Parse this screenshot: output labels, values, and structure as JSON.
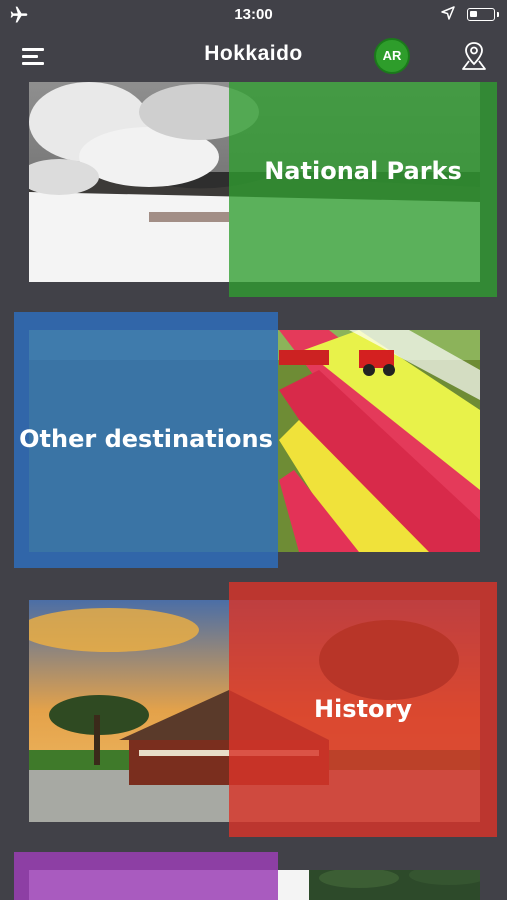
{
  "status_bar": {
    "time": "13:00",
    "battery_level": 0.35
  },
  "header": {
    "title": "Hokkaido",
    "ar_label": "AR"
  },
  "categories": [
    {
      "label": "National Parks",
      "color": "#2f9e2f"
    },
    {
      "label": "Other destinations",
      "color": "#2e6fbe"
    },
    {
      "label": "History",
      "color": "#d8352a"
    },
    {
      "label": "",
      "color": "#9b3fb5"
    }
  ]
}
